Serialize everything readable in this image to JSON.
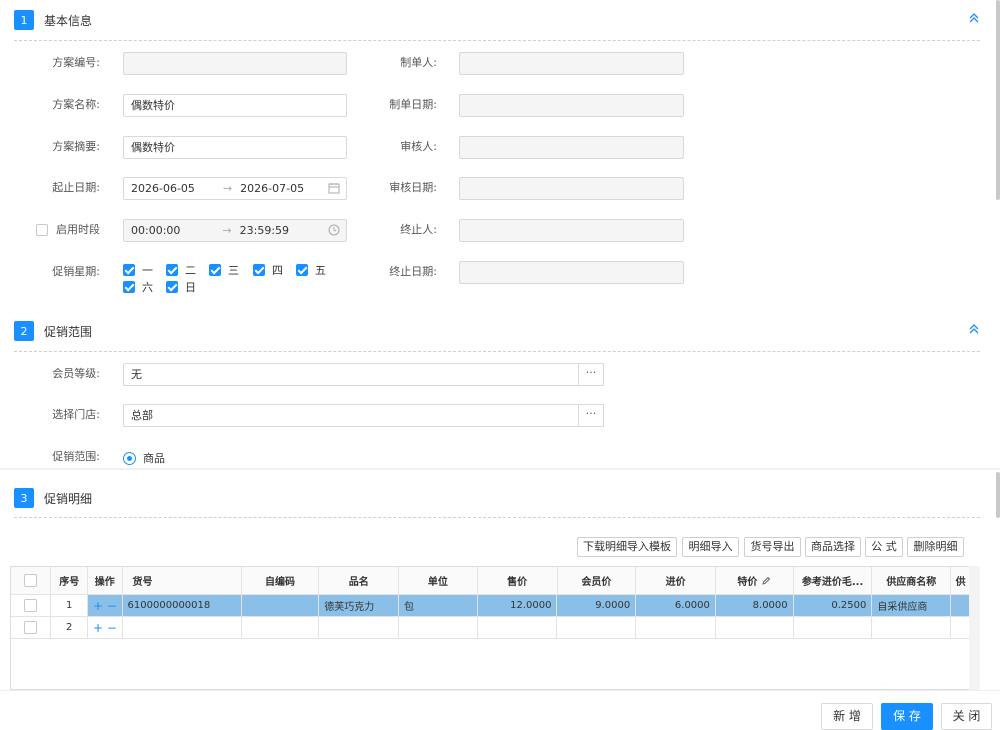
{
  "sections": [
    {
      "num": "1",
      "title": "基本信息"
    },
    {
      "num": "2",
      "title": "促销范围"
    },
    {
      "num": "3",
      "title": "促销明细"
    }
  ],
  "basic": {
    "plan_no_label": "方案编号:",
    "plan_no": "",
    "plan_name_label": "方案名称:",
    "plan_name": "偶数特价",
    "plan_summary_label": "方案摘要:",
    "plan_summary": "偶数特价",
    "date_label": "起止日期:",
    "date_start": "2026-06-05",
    "date_end": "2026-07-05",
    "time_label": "启用时段",
    "time_start": "00:00:00",
    "time_end": "23:59:59",
    "weekday_label": "促销星期:",
    "weekdays": [
      "一",
      "二",
      "三",
      "四",
      "五",
      "六",
      "日"
    ],
    "maker_label": "制单人:",
    "make_date_label": "制单日期:",
    "auditor_label": "审核人:",
    "audit_date_label": "审核日期:",
    "terminator_label": "终止人:",
    "terminate_date_label": "终止日期:",
    "range_arrow": "→"
  },
  "scope": {
    "member_label": "会员等级:",
    "member_value": "无",
    "store_label": "选择门店:",
    "store_value": "总部",
    "scope_label": "促销范围:",
    "scope_value": "商品",
    "dots": "···"
  },
  "toolbar": [
    "下载明细导入模板",
    "明细导入",
    "货号导出",
    "商品选择",
    "公 式",
    "删除明细"
  ],
  "grid": {
    "headers": [
      "序号",
      "操作",
      "货号",
      "自编码",
      "品名",
      "单位",
      "售价",
      "会员价",
      "进价",
      "特价",
      "参考进价毛...",
      "供应商名称",
      "供"
    ],
    "rows": [
      {
        "seq": "1",
        "op": "+ −",
        "code": "6100000000018",
        "selfcode": "",
        "name": "德芙巧克力",
        "unit": "包",
        "price": "12.0000",
        "member_price": "9.0000",
        "cost": "6.0000",
        "special": "8.0000",
        "ref": "0.2500",
        "supplier": "自采供应商"
      },
      {
        "seq": "2",
        "op": "+ −",
        "code": "",
        "selfcode": "",
        "name": "",
        "unit": "",
        "price": "",
        "member_price": "",
        "cost": "",
        "special": "",
        "ref": "",
        "supplier": ""
      }
    ]
  },
  "footer": {
    "add": "新 增",
    "save": "保 存",
    "close": "关 闭"
  },
  "colors": {
    "accent": "#1890ff",
    "selected_row": "#8ac0e8"
  }
}
